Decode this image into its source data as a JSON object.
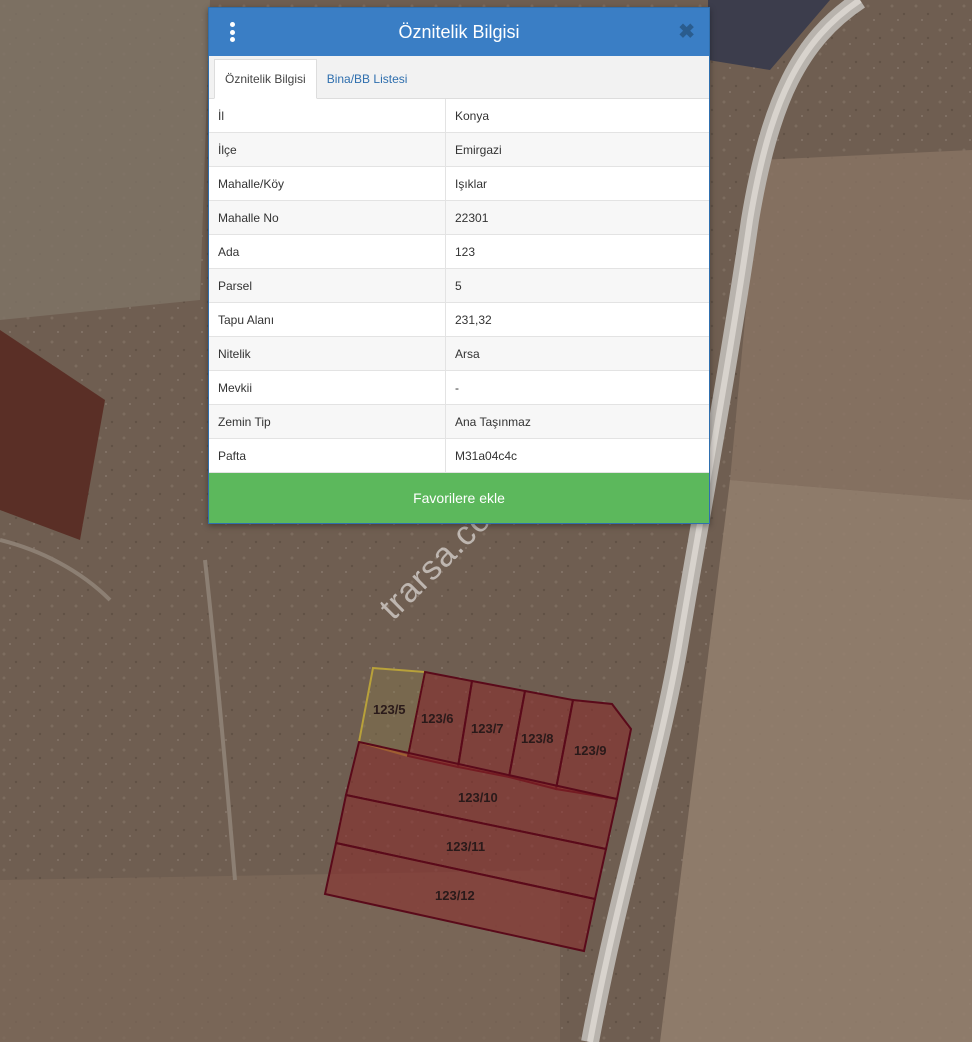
{
  "panel": {
    "title": "Öznitelik Bilgisi",
    "tabs": [
      {
        "label": "Öznitelik Bilgisi",
        "active": true
      },
      {
        "label": "Bina/BB Listesi",
        "active": false
      }
    ],
    "rows": [
      {
        "key": "İl",
        "value": "Konya"
      },
      {
        "key": "İlçe",
        "value": "Emirgazi"
      },
      {
        "key": "Mahalle/Köy",
        "value": "Işıklar"
      },
      {
        "key": "Mahalle No",
        "value": "22301"
      },
      {
        "key": "Ada",
        "value": "123"
      },
      {
        "key": "Parsel",
        "value": "5"
      },
      {
        "key": "Tapu Alanı",
        "value": "231,32"
      },
      {
        "key": "Nitelik",
        "value": "Arsa"
      },
      {
        "key": "Mevkii",
        "value": "-"
      },
      {
        "key": "Zemin Tip",
        "value": "Ana Taşınmaz"
      },
      {
        "key": "Pafta",
        "value": "M31a04c4c"
      }
    ],
    "favorite_button": "Favorilere ekle",
    "menu_icon": "vertical-ellipsis-icon",
    "close_icon": "close-icon"
  },
  "map": {
    "watermark": "trarsa.com",
    "parcels": [
      {
        "label": "123/5",
        "selected": true
      },
      {
        "label": "123/6",
        "selected": false
      },
      {
        "label": "123/7",
        "selected": false
      },
      {
        "label": "123/8",
        "selected": false
      },
      {
        "label": "123/9",
        "selected": false
      },
      {
        "label": "123/10",
        "selected": false
      },
      {
        "label": "123/11",
        "selected": false
      },
      {
        "label": "123/12",
        "selected": false
      }
    ],
    "colors": {
      "parcel_fill": "#8b2a2a",
      "parcel_stroke": "#5a0a1a",
      "selected_stroke": "#b8a13a",
      "header": "#3a7ec5",
      "button": "#5cb85c"
    }
  }
}
